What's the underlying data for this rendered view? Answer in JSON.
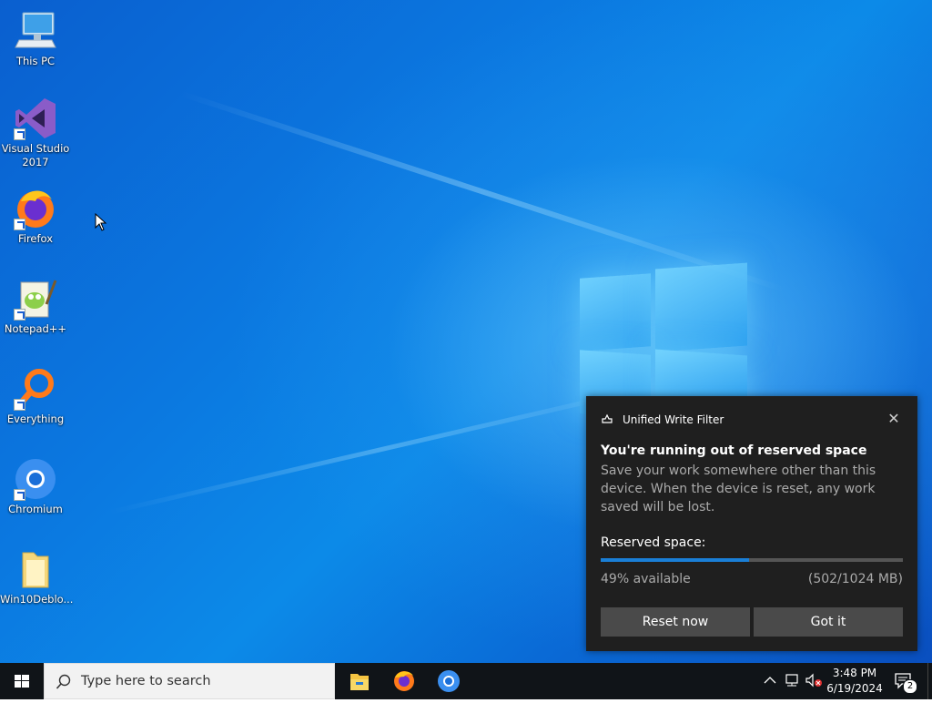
{
  "desktop": {
    "icons": [
      {
        "label": "This PC",
        "icon": "computer-icon"
      },
      {
        "label": "Visual Studio\n2017",
        "icon": "visual-studio-icon"
      },
      {
        "label": "Firefox",
        "icon": "firefox-icon"
      },
      {
        "label": "Notepad++",
        "icon": "notepadpp-icon"
      },
      {
        "label": "Everything",
        "icon": "everything-search-icon"
      },
      {
        "label": "Chromium",
        "icon": "chromium-icon"
      },
      {
        "label": "Win10Deblo...",
        "icon": "folder-icon"
      }
    ]
  },
  "toast": {
    "app_name": "Unified Write Filter",
    "title": "You're running out of reserved space",
    "body": "Save your work somewhere other than this device. When the device is reset, any work saved will be lost.",
    "reserved_label": "Reserved space:",
    "available_text": "49% available",
    "usage_text": "(502/1024 MB)",
    "progress_fraction": 0.49,
    "reset_button": "Reset now",
    "got_it_button": "Got it",
    "accent_color": "#1a7fd6"
  },
  "taskbar": {
    "search_placeholder": "Type here to search",
    "pinned_apps": [
      "file-explorer-icon",
      "firefox-icon",
      "chromium-icon"
    ],
    "tray_icons": [
      "chevron-up-icon",
      "network-icon",
      "volume-muted-icon"
    ],
    "time": "3:48 PM",
    "date": "6/19/2024",
    "notification_count": "2"
  }
}
